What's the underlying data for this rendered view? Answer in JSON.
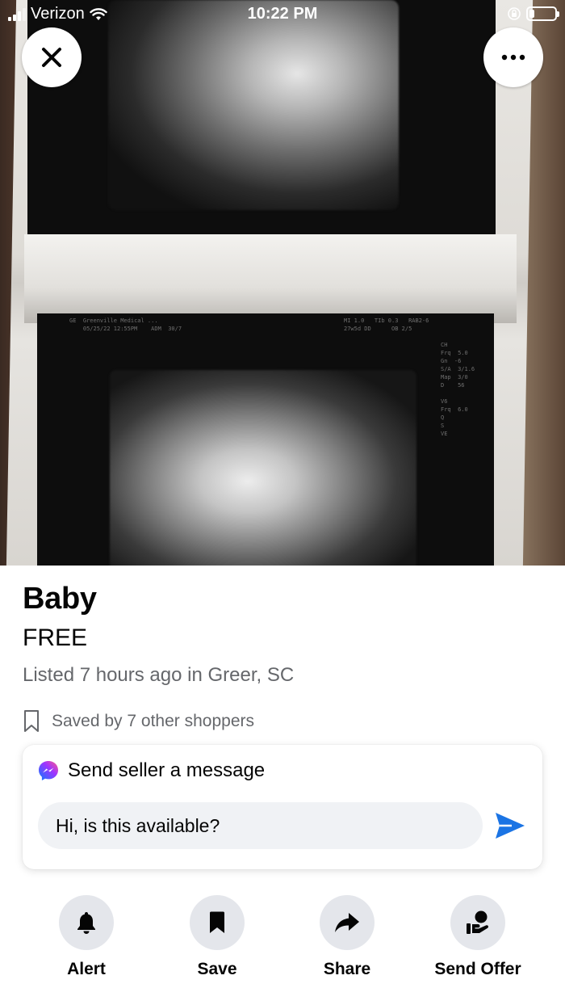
{
  "status_bar": {
    "carrier": "Verizon",
    "time": "10:22 PM",
    "battery_level": 0.2
  },
  "photo": {
    "description_icon": "ultrasound-photo",
    "scan_text_1": "GE  Greenville Medical ... \n    05/25/22 12:55PM    ADM  30/7",
    "scan_text_2": "MI 1.0   TIb 0.3   RAB2-6\n27w5d DD      OB 2/5",
    "scan_text_3": "CH\nFrq  5.0\nGn  -6\nS/A  3/1.6\nMap  3/0\nD    56\n\nV6\nFrq  6.0\nQ\nS\nVE"
  },
  "overlay": {
    "close_icon": "close-icon",
    "more_icon": "more-horizontal-icon"
  },
  "listing": {
    "title": "Baby",
    "price": "FREE",
    "listed": "Listed 7 hours ago in Greer, SC",
    "saved": "Saved by 7 other shoppers"
  },
  "message": {
    "heading": "Send seller a message",
    "input_value": "Hi, is this available?",
    "send_icon": "send-icon"
  },
  "actions": [
    {
      "label": "Alert",
      "icon": "bell-icon"
    },
    {
      "label": "Save",
      "icon": "bookmark-icon"
    },
    {
      "label": "Share",
      "icon": "share-arrow-icon"
    },
    {
      "label": "Send Offer",
      "icon": "offer-hand-icon"
    }
  ],
  "colors": {
    "accent": "#1b74e4",
    "secondary_text": "#65676b",
    "button_bg": "#e4e6eb",
    "input_bg": "#f0f2f5"
  }
}
